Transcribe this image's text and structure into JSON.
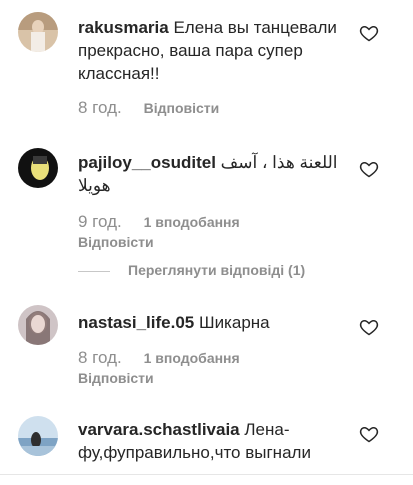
{
  "comments": [
    {
      "username": "rakusmaria",
      "text": "Елена вы танцевали прекрасно, ваша пара супер классная!!",
      "time": "8 год.",
      "likes": "",
      "reply": "Відповісти"
    },
    {
      "username": "pajiloy__osuditel",
      "text": "اللعنة هذا ، آسف هويلا",
      "time": "9 год.",
      "likes": "1 вподобання",
      "reply": "Відповісти",
      "view_replies": "Переглянути відповіді (1)"
    },
    {
      "username": "nastasi_life.05",
      "text": "Шикарна",
      "time": "8 год.",
      "likes": "1 вподобання",
      "reply": "Відповісти"
    },
    {
      "username": "varvara.schastlivaia",
      "text": "Лена-фу,фуправильно,что выгнали",
      "time": "",
      "likes": "",
      "reply": ""
    }
  ],
  "icons": {
    "like": "heart-outline-icon"
  },
  "colors": {
    "text": "#262626",
    "muted": "#8e8e8e"
  }
}
